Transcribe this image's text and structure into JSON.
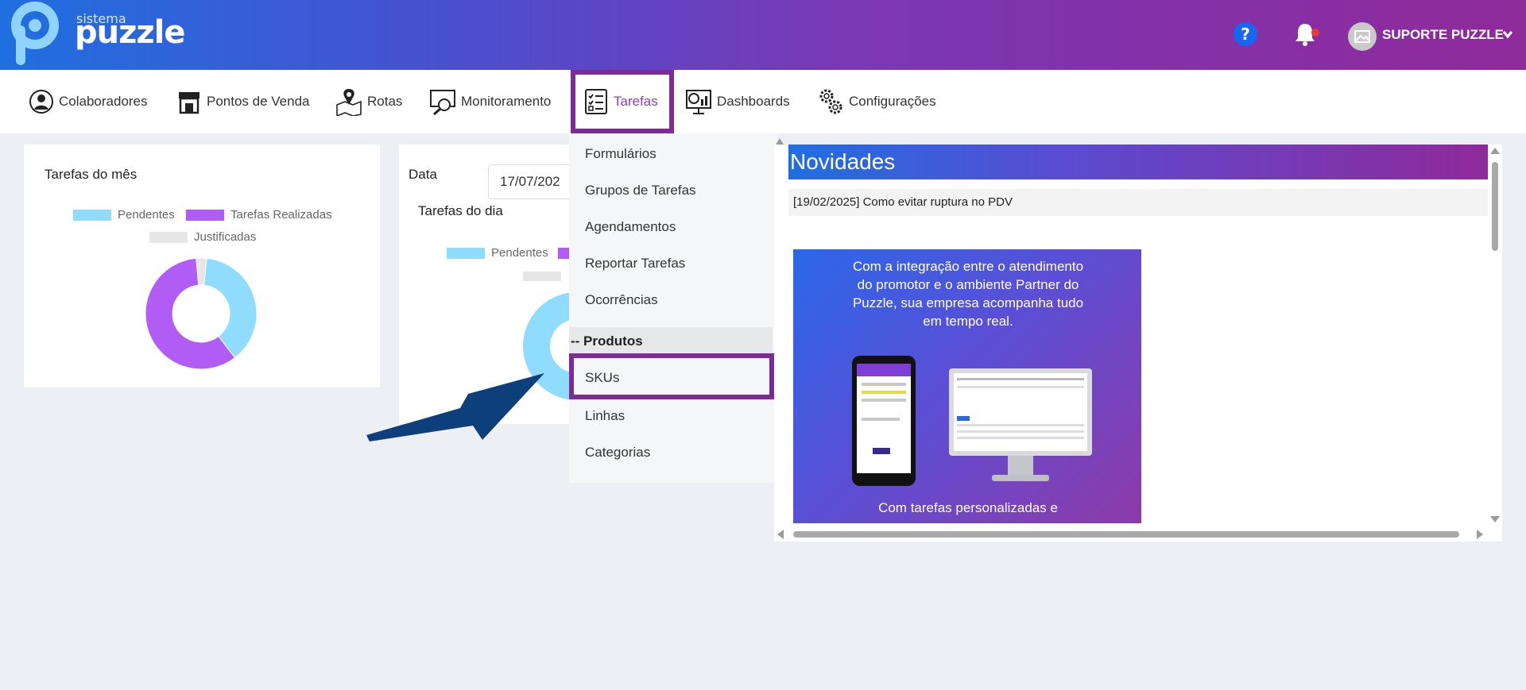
{
  "header": {
    "logo_small": "sistema",
    "logo_big": "puzzle",
    "user_name": "SUPORTE PUZZLE",
    "colors": {
      "gradient_start": "#1f6fe0",
      "gradient_end": "#8f2a9a",
      "accent": "#7c2c96"
    }
  },
  "nav": {
    "items": [
      {
        "label": "Colaboradores",
        "icon": "user-circle-icon"
      },
      {
        "label": "Pontos de Venda",
        "icon": "store-icon"
      },
      {
        "label": "Rotas",
        "icon": "map-pin-icon"
      },
      {
        "label": "Monitoramento",
        "icon": "monitor-search-icon"
      },
      {
        "label": "Tarefas",
        "icon": "checklist-icon"
      },
      {
        "label": "Dashboards",
        "icon": "dashboard-icon"
      },
      {
        "label": "Configurações",
        "icon": "gears-icon"
      }
    ],
    "active": "Tarefas"
  },
  "month_card": {
    "title": "Tarefas do mês",
    "legend": [
      "Pendentes",
      "Tarefas Realizadas",
      "Justificadas"
    ]
  },
  "day_card": {
    "date_label": "Data",
    "date_value": "17/07/202",
    "title": "Tarefas do dia",
    "legend": [
      "Pendentes"
    ]
  },
  "chart_data": {
    "type": "pie",
    "title": "Tarefas do mês",
    "categories": [
      "Pendentes",
      "Tarefas Realizadas",
      "Justificadas"
    ],
    "values": [
      38,
      59,
      3
    ],
    "colors": [
      "#8fdcff",
      "#b15cf5",
      "#e6e6e6"
    ]
  },
  "dropdown": {
    "items": [
      "Formulários",
      "Grupos de Tarefas",
      "Agendamentos",
      "Reportar Tarefas",
      "Ocorrências"
    ],
    "group_label": "-- Produtos",
    "group_items": [
      "SKUs",
      "Linhas",
      "Categorias"
    ],
    "highlighted": "SKUs"
  },
  "news": {
    "title": "Novidades",
    "subtitle": "[19/02/2025] Como evitar ruptura no PDV",
    "promo_lines": [
      "Com a integração entre o atendimento",
      "do promotor e o ambiente Partner do",
      "Puzzle, sua empresa acompanha tudo",
      "em tempo real."
    ],
    "promo_bottom": "Com tarefas personalizadas e"
  }
}
